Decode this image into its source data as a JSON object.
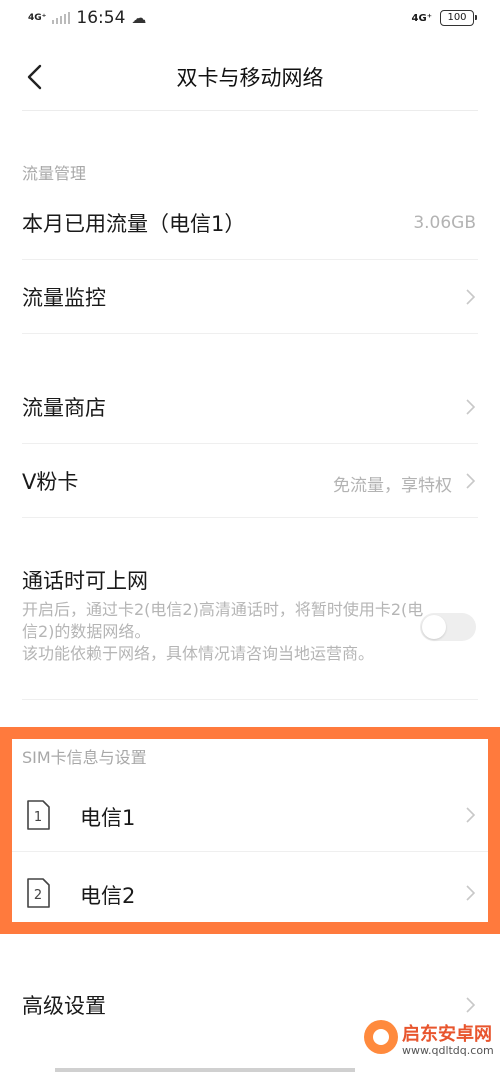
{
  "status_bar": {
    "network": "4G⁺",
    "time": "16:54",
    "right_network": "4G⁺",
    "battery": "100"
  },
  "header": {
    "title": "双卡与移动网络"
  },
  "traffic": {
    "section_label": "流量管理",
    "used_label": "本月已用流量（电信1）",
    "used_value": "3.06GB",
    "monitor_label": "流量监控",
    "store_label": "流量商店",
    "vcard_label": "V粉卡",
    "vcard_value": "免流量，享特权"
  },
  "call_data": {
    "label": "通话时可上网",
    "description_1": "开启后，通过卡2(电信2)高清通话时，将暂时使用卡2(电信2)的数据网络。",
    "description_2": "该功能依赖于网络，具体情况请咨询当地运营商。",
    "enabled": false
  },
  "sim": {
    "section_label": "SIM卡信息与设置",
    "cards": [
      {
        "icon_number": "1",
        "name": "电信1"
      },
      {
        "icon_number": "2",
        "name": "电信2"
      }
    ],
    "highlight_color": "#ff7a3d"
  },
  "advanced": {
    "label": "高级设置"
  },
  "watermark": {
    "title": "启东安卓网",
    "url": "www.qdltdq.com"
  },
  "icons": {
    "back": "back-arrow-icon",
    "chevron": "chevron-right-icon",
    "sim": "sim-card-icon",
    "weather": "cloud-icon"
  }
}
